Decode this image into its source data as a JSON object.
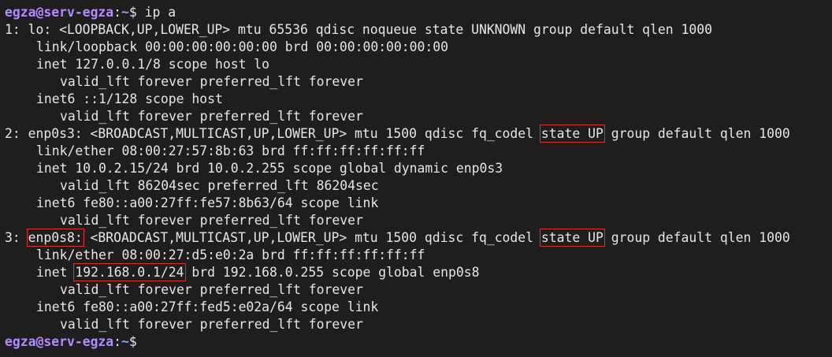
{
  "prompt": {
    "user": "egza",
    "at": "@",
    "host": "serv-egza",
    "colon": ":",
    "path": "~",
    "dollar": "$"
  },
  "command": "ip a",
  "colors": {
    "background": "#1e1e1e",
    "text": "#e6e6e6",
    "prompt_user": "#b38bff",
    "prompt_path": "#7ea8ff",
    "highlight_box": "#d93030"
  },
  "iface1": {
    "head": "1: lo: <LOOPBACK,UP,LOWER_UP> mtu 65536 qdisc noqueue state UNKNOWN group default qlen 1000",
    "link": "link/loopback 00:00:00:00:00:00 brd 00:00:00:00:00:00",
    "inet": "inet 127.0.0.1/8 scope host lo",
    "inet_lft": "valid_lft forever preferred_lft forever",
    "inet6": "inet6 ::1/128 scope host",
    "inet6_lft": "valid_lft forever preferred_lft forever"
  },
  "iface2": {
    "head_pre": "2: enp0s3: <BROADCAST,MULTICAST,UP,LOWER_UP> mtu 1500 qdisc fq_codel ",
    "head_state": "state UP",
    "head_post": " group default qlen 1000",
    "link": "link/ether 08:00:27:57:8b:63 brd ff:ff:ff:ff:ff:ff",
    "inet": "inet 10.0.2.15/24 brd 10.0.2.255 scope global dynamic enp0s3",
    "inet_lft": "valid_lft 86204sec preferred_lft 86204sec",
    "inet6": "inet6 fe80::a00:27ff:fe57:8b63/64 scope link",
    "inet6_lft": "valid_lft forever preferred_lft forever"
  },
  "iface3": {
    "head_num": "3: ",
    "head_name": "enp0s8:",
    "head_mid": " <BROADCAST,MULTICAST,UP,LOWER_UP> mtu 1500 qdisc fq_codel ",
    "head_state": "state UP",
    "head_post": " group default qlen 1000",
    "link": "link/ether 08:00:27:d5:e0:2a brd ff:ff:ff:ff:ff:ff",
    "inet_pre": "inet ",
    "inet_addr": "192.168.0.1/24",
    "inet_post": " brd 192.168.0.255 scope global enp0s8",
    "inet_lft": "valid_lft forever preferred_lft forever",
    "inet6": "inet6 fe80::a00:27ff:fed5:e02a/64 scope link",
    "inet6_lft": "valid_lft forever preferred_lft forever"
  }
}
